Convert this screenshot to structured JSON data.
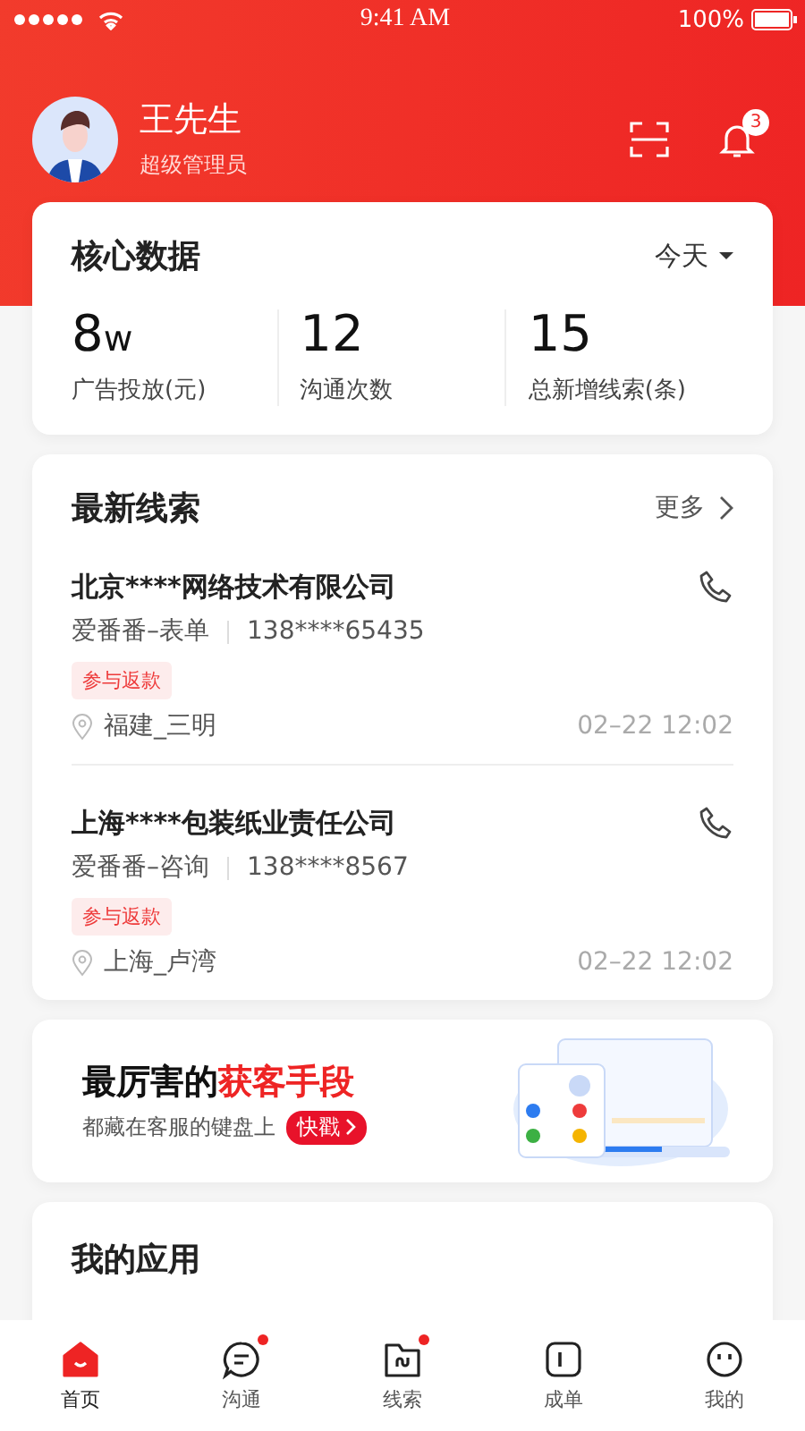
{
  "status_bar": {
    "time": "9:41 AM",
    "battery": "100%"
  },
  "header": {
    "name": "王先生",
    "role": "超级管理员",
    "notifications": "3"
  },
  "core_data": {
    "title": "核心数据",
    "period": "今天",
    "stats": [
      {
        "value": "8",
        "unit": "w",
        "label": "广告投放(元)"
      },
      {
        "value": "12",
        "label": "沟通次数"
      },
      {
        "value": "15",
        "label": "总新增线索(条)"
      }
    ]
  },
  "leads": {
    "title": "最新线索",
    "more": "更多",
    "items": [
      {
        "company": "北京****网络技术有限公司",
        "source": "爱番番–表单",
        "phone": "138****65435",
        "tag": "参与返款",
        "location": "福建_三明",
        "time": "02–22 12:02"
      },
      {
        "company": "上海****包装纸业责任公司",
        "source": "爱番番–咨询",
        "phone": "138****8567",
        "tag": "参与返款",
        "location": "上海_卢湾",
        "time": "02–22 12:02"
      }
    ]
  },
  "banner": {
    "title": "最厉害的**获客手段**",
    "subtitle": "都藏在客服的键盘上",
    "button": "快戳"
  },
  "apps": {
    "title": "我的应用"
  },
  "tab_bar": [
    {
      "kind": "home",
      "label": "首页",
      "selected": true,
      "badge": false
    },
    {
      "kind": "chat",
      "label": "沟通",
      "selected": false,
      "badge": true
    },
    {
      "kind": "folder",
      "label": "线索",
      "selected": false,
      "badge": true
    },
    {
      "kind": "order",
      "label": "成单",
      "selected": false,
      "badge": false
    },
    {
      "kind": "me",
      "label": "我的",
      "selected": false,
      "badge": false
    }
  ]
}
